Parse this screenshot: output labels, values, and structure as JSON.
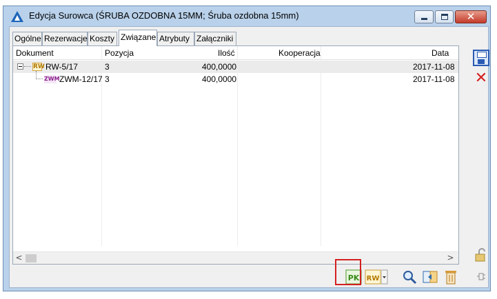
{
  "window": {
    "title": "Edycja Surowca (ŚRUBA OZDOBNA 15MM; Śruba ozdobna 15mm)",
    "close_glyph": "✕"
  },
  "tabs": [
    {
      "label": "Ogólne"
    },
    {
      "label": "Rezerwacje"
    },
    {
      "label": "Koszty"
    },
    {
      "label": "Związane",
      "active": true
    },
    {
      "label": "Atrybuty"
    },
    {
      "label": "Załączniki"
    }
  ],
  "grid": {
    "columns": [
      "Dokument",
      "Pozycja",
      "Ilość",
      "Kooperacja",
      "Data"
    ],
    "rows": [
      {
        "dokument": "RW-5/17",
        "icon": "RW",
        "pozycja": "3",
        "ilosc": "400,0000",
        "kooperacja": "",
        "data": "2017-11-08"
      },
      {
        "dokument": "ZWM-12/17",
        "icon": "ZWM",
        "pozycja": "3",
        "ilosc": "400,0000",
        "kooperacja": "",
        "data": "2017-11-08"
      }
    ]
  },
  "scrollbar": {
    "left_arrow": "<",
    "right_arrow": ">"
  },
  "icons": {
    "save": "save-icon",
    "delete": "delete-icon",
    "lock": "lock-icon",
    "pin": "pin-icon",
    "pk": "pk-document-icon",
    "rw": "rw-document-icon",
    "search": "search-icon",
    "link": "link-icon",
    "trash": "trash-icon"
  },
  "toolbar": {
    "pk_label": "PK",
    "rw_label": "RW",
    "delete_glyph": "✕"
  },
  "colors": {
    "highlight": "#d42020",
    "window_border": "#b9d1ea",
    "selected_row": "#ebebeb"
  }
}
